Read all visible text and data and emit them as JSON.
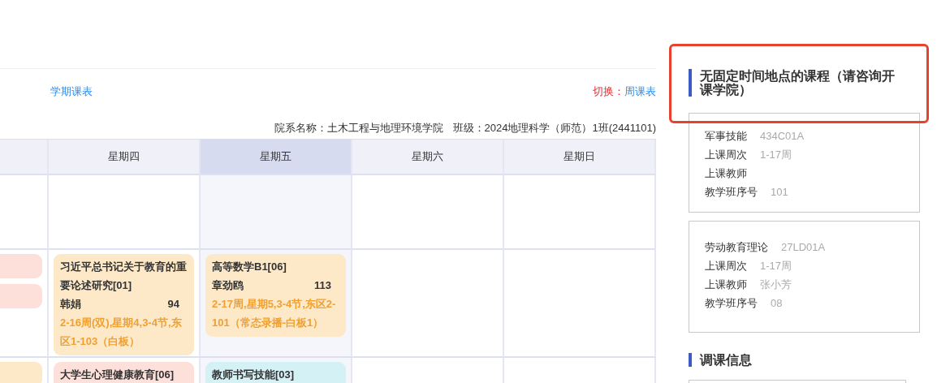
{
  "toolbar": {
    "semester_link": "学期课表",
    "switch_label": "切换：",
    "week_link": "周课表"
  },
  "class_info": {
    "department": "院系名称：土木工程与地理环境学院",
    "class": "班级：2024地理科学（师范）1班(2441101)"
  },
  "timetable": {
    "columns": [
      {
        "selected": false
      },
      {
        "label": "星期四",
        "selected": false
      },
      {
        "label": "星期五",
        "selected": true
      },
      {
        "label": "星期六",
        "selected": false
      },
      {
        "label": "星期日",
        "selected": false
      }
    ],
    "rows": [
      {
        "cells": [
          [],
          [],
          [],
          [],
          []
        ]
      },
      {
        "cells": [
          [
            {
              "color": "#fde0da"
            },
            {
              "color": "#fde0da"
            }
          ],
          [
            {
              "color": "#fde8c8",
              "name": "习近平总书记关于教育的重要论述研究[01]",
              "teacher": "韩娟",
              "count": "94",
              "details": "2-16周(双),星期4,3-4节,东区1-103（白板）"
            }
          ],
          [
            {
              "color": "#fde8c8",
              "name": "高等数学B1[06]",
              "teacher": "章劲鸥",
              "count": "113",
              "details": "2-17周,星期5,3-4节,东区2-101（常态录播-白板1）"
            }
          ],
          [],
          []
        ]
      },
      {
        "cells": [
          [
            {
              "color": "#fde8c8"
            }
          ],
          [
            {
              "color": "#fde0da",
              "name": "大学生心理健康教育[06]"
            }
          ],
          [
            {
              "color": "#d4f1f6",
              "name": "教师书写技能[03]"
            }
          ],
          [],
          []
        ]
      }
    ]
  },
  "unscheduled": {
    "title": "无固定时间地点的课程（请咨询开课学院）",
    "courses": [
      {
        "name": "军事技能",
        "code": "434C01A",
        "weeks_label": "上课周次",
        "weeks": "1-17周",
        "teacher_label": "上课教师",
        "seq_label": "教学班序号",
        "seq": "101"
      },
      {
        "name": "劳动教育理论",
        "code": "27LD01A",
        "weeks_label": "上课周次",
        "weeks": "1-17周",
        "teacher_label": "上课教师",
        "teacher": "张小芳",
        "seq_label": "教学班序号",
        "seq": "08"
      }
    ]
  },
  "adjustments": {
    "title": "调课信息"
  },
  "annotation": {
    "kind": "highlight-box"
  }
}
